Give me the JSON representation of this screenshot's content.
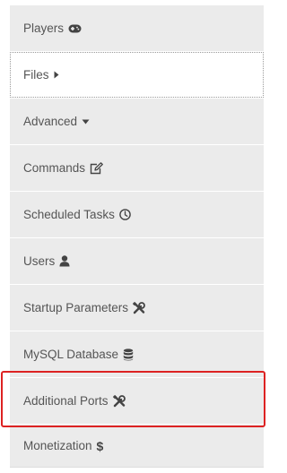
{
  "menu": {
    "items": [
      {
        "label": "Players",
        "icon": "gamepad-icon"
      },
      {
        "label": "Files",
        "icon": "caret-right-icon"
      },
      {
        "label": "Advanced",
        "icon": "caret-down-icon"
      },
      {
        "label": "Commands",
        "icon": "edit-icon"
      },
      {
        "label": "Scheduled Tasks",
        "icon": "clock-icon"
      },
      {
        "label": "Users",
        "icon": "user-icon"
      },
      {
        "label": "Startup Parameters",
        "icon": "tools-icon"
      },
      {
        "label": "MySQL Database",
        "icon": "database-icon"
      },
      {
        "label": "Additional Ports",
        "icon": "tools-icon"
      },
      {
        "label": "Monetization",
        "icon": "dollar-icon"
      }
    ]
  },
  "highlight": {
    "color": "#dd2222",
    "target": "Additional Ports"
  }
}
